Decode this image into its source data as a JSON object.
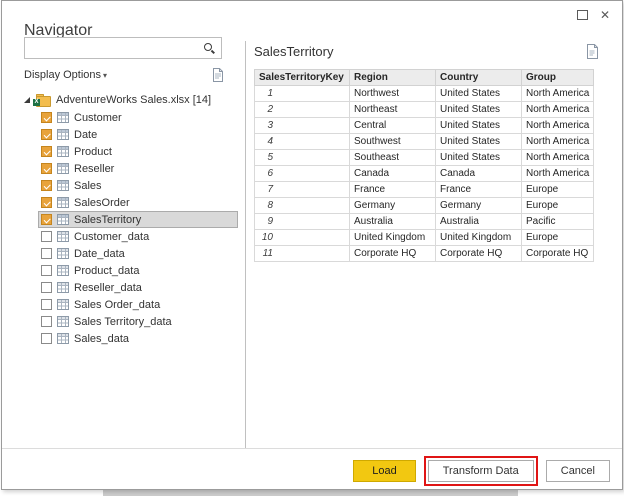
{
  "window": {
    "title": "Navigator",
    "close_glyph": "✕"
  },
  "left_panel": {
    "search": {
      "placeholder": ""
    },
    "display_options_label": "Display Options",
    "display_options_caret": "▾",
    "tree": {
      "root": {
        "label": "AdventureWorks Sales.xlsx [14]",
        "badge_letter": "X"
      },
      "items": [
        {
          "label": "Customer",
          "checked": true,
          "selected": false,
          "icon": "table"
        },
        {
          "label": "Date",
          "checked": true,
          "selected": false,
          "icon": "table"
        },
        {
          "label": "Product",
          "checked": true,
          "selected": false,
          "icon": "table"
        },
        {
          "label": "Reseller",
          "checked": true,
          "selected": false,
          "icon": "table"
        },
        {
          "label": "Sales",
          "checked": true,
          "selected": false,
          "icon": "table"
        },
        {
          "label": "SalesOrder",
          "checked": true,
          "selected": false,
          "icon": "table"
        },
        {
          "label": "SalesTerritory",
          "checked": true,
          "selected": true,
          "icon": "table"
        },
        {
          "label": "Customer_data",
          "checked": false,
          "selected": false,
          "icon": "sheet"
        },
        {
          "label": "Date_data",
          "checked": false,
          "selected": false,
          "icon": "sheet"
        },
        {
          "label": "Product_data",
          "checked": false,
          "selected": false,
          "icon": "sheet"
        },
        {
          "label": "Reseller_data",
          "checked": false,
          "selected": false,
          "icon": "sheet"
        },
        {
          "label": "Sales Order_data",
          "checked": false,
          "selected": false,
          "icon": "sheet"
        },
        {
          "label": "Sales Territory_data",
          "checked": false,
          "selected": false,
          "icon": "sheet"
        },
        {
          "label": "Sales_data",
          "checked": false,
          "selected": false,
          "icon": "sheet"
        }
      ]
    }
  },
  "preview": {
    "title": "SalesTerritory",
    "table": {
      "columns": [
        "SalesTerritoryKey",
        "Region",
        "Country",
        "Group"
      ],
      "rows": [
        [
          "1",
          "Northwest",
          "United States",
          "North America"
        ],
        [
          "2",
          "Northeast",
          "United States",
          "North America"
        ],
        [
          "3",
          "Central",
          "United States",
          "North America"
        ],
        [
          "4",
          "Southwest",
          "United States",
          "North America"
        ],
        [
          "5",
          "Southeast",
          "United States",
          "North America"
        ],
        [
          "6",
          "Canada",
          "Canada",
          "North America"
        ],
        [
          "7",
          "France",
          "France",
          "Europe"
        ],
        [
          "8",
          "Germany",
          "Germany",
          "Europe"
        ],
        [
          "9",
          "Australia",
          "Australia",
          "Pacific"
        ],
        [
          "10",
          "United Kingdom",
          "United Kingdom",
          "Europe"
        ],
        [
          "11",
          "Corporate HQ",
          "Corporate HQ",
          "Corporate HQ"
        ]
      ]
    }
  },
  "footer": {
    "load_label": "Load",
    "transform_label": "Transform Data",
    "cancel_label": "Cancel"
  },
  "colors": {
    "accent_yellow": "#f2c811",
    "checkbox_checked": "#e8a33b",
    "annotation_red": "#e01515",
    "selection_gray": "#d9d9d9"
  }
}
